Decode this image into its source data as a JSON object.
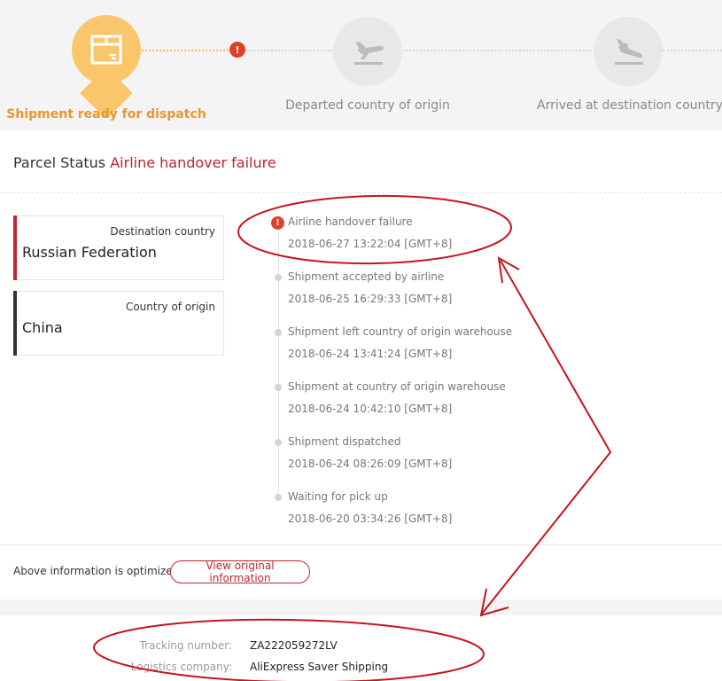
{
  "progress": {
    "steps": [
      {
        "label": "Shipment ready for dispatch",
        "icon": "package-icon",
        "state": "active"
      },
      {
        "label": "Departed country of origin",
        "icon": "plane-takeoff-icon",
        "state": "pending"
      },
      {
        "label": "Arrived at destination country",
        "icon": "plane-landing-icon",
        "state": "pending"
      }
    ],
    "alert_glyph": "!"
  },
  "parcel": {
    "status_label": "Parcel Status",
    "status_value": "Airline handover failure"
  },
  "cards": {
    "destination": {
      "label": "Destination country",
      "value": "Russian Federation",
      "bar_color": "#c0262e"
    },
    "origin": {
      "label": "Country of origin",
      "value": "China",
      "bar_color": "#333333"
    }
  },
  "events": [
    {
      "title": "Airline handover failure",
      "time": "2018-06-27 13:22:04 [GMT+8]",
      "alert": true
    },
    {
      "title": "Shipment accepted by airline",
      "time": "2018-06-25 16:29:33 [GMT+8]"
    },
    {
      "title": "Shipment left country of origin warehouse",
      "time": "2018-06-24 13:41:24 [GMT+8]"
    },
    {
      "title": "Shipment at country of origin warehouse",
      "time": "2018-06-24 10:42:10 [GMT+8]"
    },
    {
      "title": "Shipment dispatched",
      "time": "2018-06-24 08:26:09 [GMT+8]"
    },
    {
      "title": "Waiting for pick up",
      "time": "2018-06-20 03:34:26 [GMT+8]"
    }
  ],
  "footer": {
    "optimized_text": "Above information is optimized",
    "view_button": "View original information"
  },
  "logistics": {
    "tracking_label": "Tracking number:",
    "tracking_value": "ZA222059272LV",
    "company_label": "Logistics company:",
    "company_value": "AliExpress Saver Shipping"
  },
  "colors": {
    "accent_red": "#c0262e",
    "active_orange": "#f9c66b",
    "annotation_red": "#c8141e"
  }
}
